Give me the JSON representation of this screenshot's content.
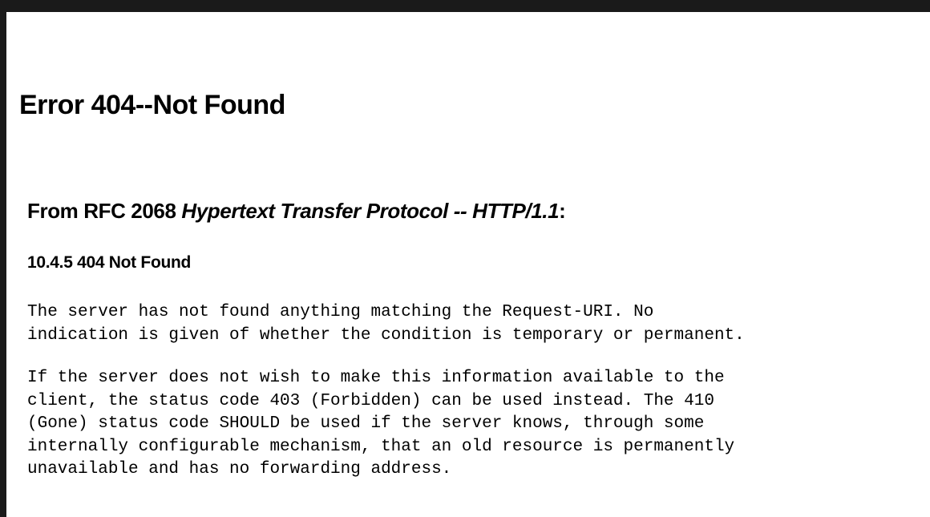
{
  "error_page": {
    "title": "Error 404--Not Found",
    "rfc_heading": {
      "prefix": "From RFC 2068 ",
      "document_title": "Hypertext Transfer Protocol -- HTTP/1.1",
      "suffix": ":"
    },
    "section_heading": "10.4.5 404 Not Found",
    "paragraph_1": [
      "The server has not found anything matching the Request-URI. No",
      "indication is given of whether the condition is temporary or permanent."
    ],
    "paragraph_2": [
      "If the server does not wish to make this information available to the",
      "client, the status code 403 (Forbidden) can be used instead. The 410",
      "(Gone) status code SHOULD be used if the server knows, through some",
      "internally configurable mechanism, that an old resource is permanently",
      "unavailable and has no forwarding address."
    ]
  }
}
